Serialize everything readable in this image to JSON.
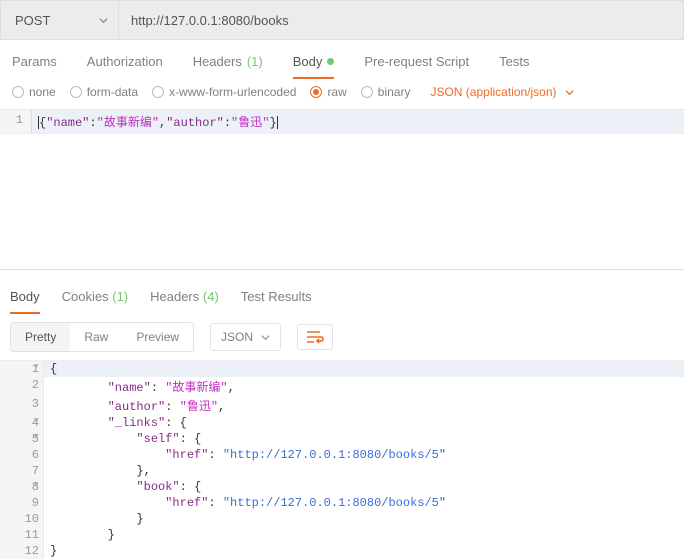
{
  "request": {
    "method": "POST",
    "url": "http://127.0.0.1:8080/books"
  },
  "reqTabs": {
    "params": "Params",
    "authorization": "Authorization",
    "headers": "Headers",
    "headersCount": "(1)",
    "body": "Body",
    "prerequest": "Pre-request Script",
    "tests": "Tests"
  },
  "bodyTypes": {
    "none": "none",
    "formData": "form-data",
    "xwww": "x-www-form-urlencoded",
    "raw": "raw",
    "binary": "binary",
    "contentType": "JSON (application/json)"
  },
  "reqEditor": {
    "line1No": "1",
    "k1": "\"name\"",
    "v1": "\"故事新编\"",
    "k2": "\"author\"",
    "v2": "\"鲁迅\""
  },
  "respTabs": {
    "body": "Body",
    "cookies": "Cookies",
    "cookiesCount": "(1)",
    "headers": "Headers",
    "headersCount": "(4)",
    "testResults": "Test Results"
  },
  "respToolbar": {
    "pretty": "Pretty",
    "raw": "Raw",
    "preview": "Preview",
    "format": "JSON"
  },
  "respBody": {
    "lines": [
      {
        "n": "1",
        "fold": true,
        "indent": 0,
        "open": "{"
      },
      {
        "n": "2",
        "indent": 2,
        "key": "\"name\"",
        "sep": ": ",
        "valCjk": "\"故事新编\"",
        "tail": ","
      },
      {
        "n": "3",
        "indent": 2,
        "key": "\"author\"",
        "sep": ": ",
        "valCjk": "\"鲁迅\"",
        "tail": ","
      },
      {
        "n": "4",
        "fold": true,
        "indent": 2,
        "key": "\"_links\"",
        "sep": ": ",
        "open": "{"
      },
      {
        "n": "5",
        "fold": true,
        "indent": 3,
        "key": "\"self\"",
        "sep": ": ",
        "open": "{"
      },
      {
        "n": "6",
        "indent": 4,
        "key": "\"href\"",
        "sep": ": ",
        "valLink": "\"http://127.0.0.1:8080/books/5\""
      },
      {
        "n": "7",
        "indent": 3,
        "close": "}",
        "tail": ","
      },
      {
        "n": "8",
        "fold": true,
        "indent": 3,
        "key": "\"book\"",
        "sep": ": ",
        "open": "{"
      },
      {
        "n": "9",
        "indent": 4,
        "key": "\"href\"",
        "sep": ": ",
        "valLink": "\"http://127.0.0.1:8080/books/5\""
      },
      {
        "n": "10",
        "indent": 3,
        "close": "}"
      },
      {
        "n": "11",
        "indent": 2,
        "close": "}"
      },
      {
        "n": "12",
        "indent": 0,
        "close": "}"
      }
    ]
  }
}
